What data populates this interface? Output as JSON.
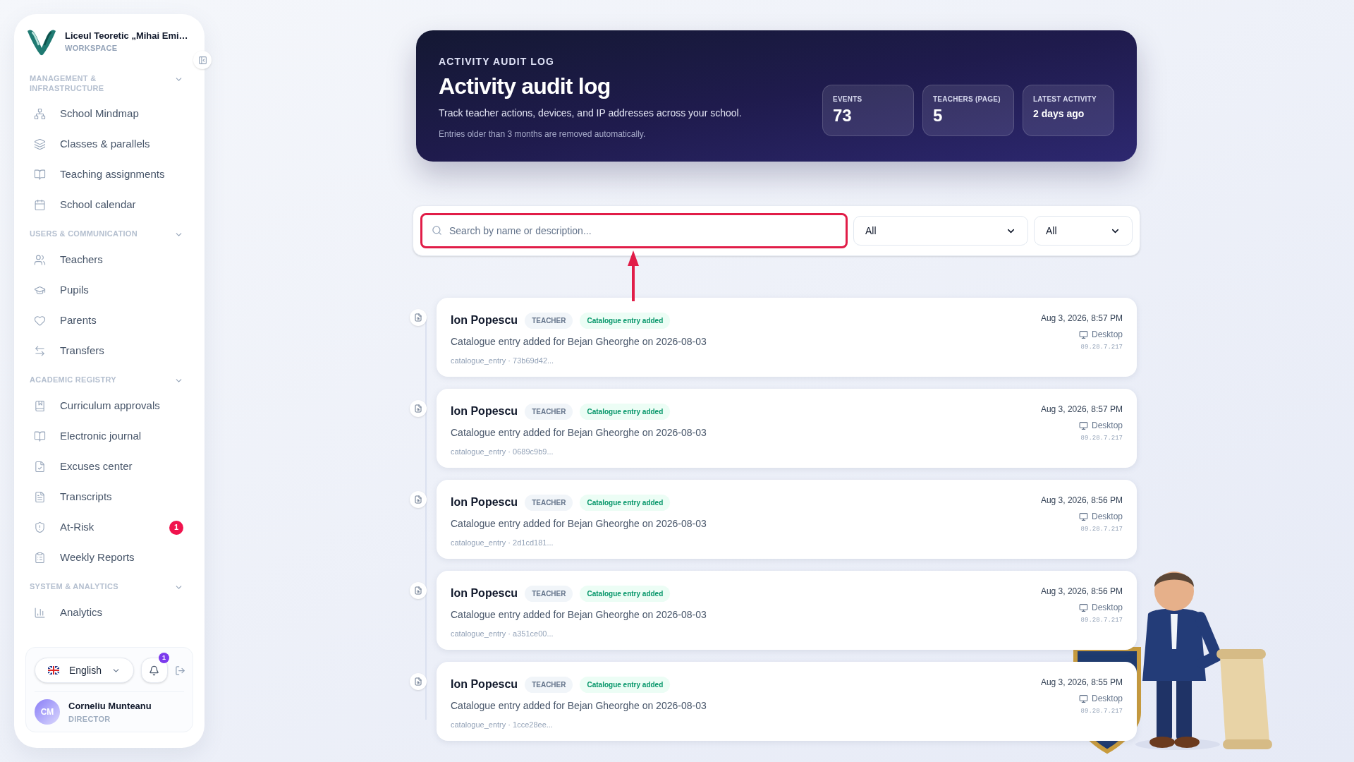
{
  "sidebar": {
    "school_name": "Liceul Teoretic „Mihai Emi…",
    "workspace_label": "WORKSPACE",
    "sections": [
      {
        "title": "MANAGEMENT & INFRASTRUCTURE",
        "expanded": true,
        "items": [
          {
            "label": "School Mindmap"
          },
          {
            "label": "Classes & parallels"
          },
          {
            "label": "Teaching assignments"
          },
          {
            "label": "School calendar"
          }
        ]
      },
      {
        "title": "USERS & COMMUNICATION",
        "expanded": true,
        "items": [
          {
            "label": "Teachers"
          },
          {
            "label": "Pupils"
          },
          {
            "label": "Parents"
          },
          {
            "label": "Transfers"
          }
        ]
      },
      {
        "title": "ACADEMIC REGISTRY",
        "expanded": true,
        "items": [
          {
            "label": "Curriculum approvals"
          },
          {
            "label": "Electronic journal"
          },
          {
            "label": "Excuses center"
          },
          {
            "label": "Transcripts"
          },
          {
            "label": "At-Risk",
            "badge": "1"
          },
          {
            "label": "Weekly Reports"
          }
        ]
      },
      {
        "title": "SYSTEM & ANALYTICS",
        "expanded": true,
        "items": [
          {
            "label": "Analytics"
          }
        ]
      }
    ],
    "language": "English",
    "notifications_count": "1",
    "user": {
      "initials": "CM",
      "name": "Corneliu Munteanu",
      "role": "DIRECTOR"
    }
  },
  "header": {
    "eyebrow": "ACTIVITY AUDIT LOG",
    "title": "Activity audit log",
    "subtitle": "Track teacher actions, devices, and IP addresses across your school.",
    "note": "Entries older than 3 months are removed automatically.",
    "stats": [
      {
        "label": "EVENTS",
        "value": "73",
        "kind": "number"
      },
      {
        "label": "TEACHERS (PAGE)",
        "value": "5",
        "kind": "number"
      },
      {
        "label": "LATEST ACTIVITY",
        "value": "2 days ago",
        "kind": "text"
      }
    ]
  },
  "filters": {
    "search": {
      "placeholder": "Search by name or description..."
    },
    "selects": [
      "All",
      "All"
    ]
  },
  "entries": [
    {
      "name": "Ion Popescu",
      "role": "TEACHER",
      "tag": "Catalogue entry added",
      "description": "Catalogue entry added for Bejan Gheorghe on 2026-08-03",
      "meta": "catalogue_entry · 73b69d42...",
      "time": "Aug 3, 2026, 8:57 PM",
      "device": "Desktop",
      "ip": "89.28.7.217"
    },
    {
      "name": "Ion Popescu",
      "role": "TEACHER",
      "tag": "Catalogue entry added",
      "description": "Catalogue entry added for Bejan Gheorghe on 2026-08-03",
      "meta": "catalogue_entry · 0689c9b9...",
      "time": "Aug 3, 2026, 8:57 PM",
      "device": "Desktop",
      "ip": "89.28.7.217"
    },
    {
      "name": "Ion Popescu",
      "role": "TEACHER",
      "tag": "Catalogue entry added",
      "description": "Catalogue entry added for Bejan Gheorghe on 2026-08-03",
      "meta": "catalogue_entry · 2d1cd181...",
      "time": "Aug 3, 2026, 8:56 PM",
      "device": "Desktop",
      "ip": "89.28.7.217"
    },
    {
      "name": "Ion Popescu",
      "role": "TEACHER",
      "tag": "Catalogue entry added",
      "description": "Catalogue entry added for Bejan Gheorghe on 2026-08-03",
      "meta": "catalogue_entry · a351ce00...",
      "time": "Aug 3, 2026, 8:56 PM",
      "device": "Desktop",
      "ip": "89.28.7.217"
    },
    {
      "name": "Ion Popescu",
      "role": "TEACHER",
      "tag": "Catalogue entry added",
      "description": "Catalogue entry added for Bejan Gheorghe on 2026-08-03",
      "meta": "catalogue_entry · 1cce28ee...",
      "time": "Aug 3, 2026, 8:55 PM",
      "device": "Desktop",
      "ip": "89.28.7.217"
    }
  ]
}
